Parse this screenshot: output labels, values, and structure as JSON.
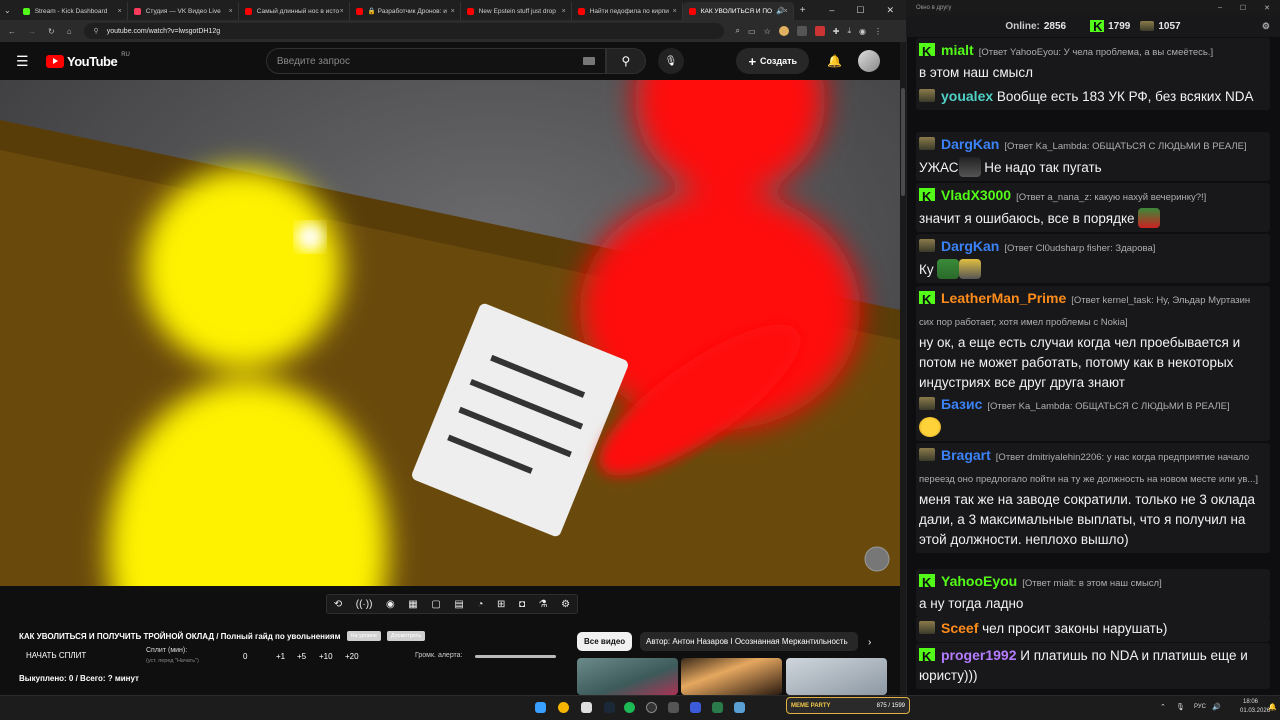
{
  "browser": {
    "tabs": [
      {
        "label": "Stream - Kick Dashboard",
        "color": "#53fc18",
        "active": false
      },
      {
        "label": "Студия — VK Видео Live",
        "color": "#ff3b5c",
        "active": false
      },
      {
        "label": "Самый длинный нос в исто",
        "color": "#ff0000",
        "active": false
      },
      {
        "label": "🔒 Разработчик Дронов: и",
        "color": "#ff0000",
        "active": false
      },
      {
        "label": "New Epstein stuff just drop",
        "color": "#ff0000",
        "active": false
      },
      {
        "label": "Найти педофила по кирпи",
        "color": "#ff0000",
        "active": false
      },
      {
        "label": "КАК УВОЛИТЬСЯ И ПО",
        "color": "#ff0000",
        "active": true
      }
    ],
    "new_tab": "+",
    "url": "youtube.com/watch?v=lwsgotDH12g"
  },
  "youtube": {
    "logo_text": "YouTube",
    "region": "RU",
    "search_placeholder": "Введите запрос",
    "create_label": "Создать",
    "create_plus": "+"
  },
  "video": {
    "title": "КАК УВОЛИТЬСЯ И ПОЛУЧИТЬ ТРОЙНОЙ ОКЛАД / Полный гайд по увольнениям",
    "chip1": "На уровне",
    "chip2": "Досмотреть"
  },
  "split": {
    "start_label": "НАЧАТЬ СПЛИТ",
    "split_label": "Сплит (мин):",
    "split_hint": "(уст. перед \"Начать\")",
    "values": [
      "0",
      "+1",
      "+5",
      "+10",
      "+20"
    ],
    "alert_label": "Громк. алерта:",
    "bought": "Выкуплено: 0 / Всего: ? минут"
  },
  "videos_row": {
    "all_label": "Все видео",
    "author_label": "Автор: Антон Назаров I Осознанная Меркантильность"
  },
  "chat": {
    "window_title": "Окно в другу",
    "online_label": "Online:",
    "online_value": "2856",
    "kick_count": "1799",
    "vk_count": "1057",
    "messages": [
      {
        "name": "mialt",
        "color": "#53fc18",
        "badge": "kick",
        "reply": "[Ответ YahooEyou: У чела проблема, а вы смеётесь.]",
        "text": "в этом наш смысл"
      },
      {
        "name": "youalex",
        "color": "#4fd1c5",
        "badge": "vk",
        "reply": "",
        "text": "Вообще есть 183 УК РФ, без всяких NDA"
      },
      {
        "name": "DargKan",
        "color": "#3b82f6",
        "badge": "vk",
        "reply": "[Ответ Ka_Lambda: ОБЩАТЬСЯ С ЛЮДЬМИ В РЕАЛЕ]",
        "text": "Не надо так пугать",
        "prefix": "УЖАС"
      },
      {
        "name": "VladX3000",
        "color": "#53fc18",
        "badge": "kick",
        "reply": "[Ответ a_nana_z: какую нахуй вечеринку?!]",
        "text": "значит я ошибаюсь, все в порядке"
      },
      {
        "name": "DargKan",
        "color": "#3b82f6",
        "badge": "vk",
        "reply": "[Ответ Cl0udsharp fisher: Здарова]",
        "text": "Ку"
      },
      {
        "name": "LeatherMan_Prime",
        "color": "#ff8c1a",
        "badge": "kick",
        "reply": "[Ответ kernel_task: Ну, Эльдар Муртазин сих пор работает, хотя имел проблемы с Nokia]",
        "text": "ну ок, а еще есть случаи когда чел проебывается и потом не может работать, потому как в некоторых индустриях все друг друга знают"
      },
      {
        "name": "Базис",
        "color": "#3b82f6",
        "badge": "vk",
        "reply": "[Ответ Ka_Lambda: ОБЩАТЬСЯ С ЛЮДЬМИ В РЕАЛЕ]",
        "text": ""
      },
      {
        "name": "Bragart",
        "color": "#3b82f6",
        "badge": "vk",
        "reply": "[Ответ dmitriyalehin2206: у нас когда предприятие начало переезд оно предлогало пойти на ту же должность на новом месте или ув...]",
        "text": "меня так же на заводе сократили. только не 3 оклада дали, а 3 максимальные выплаты, что я получил на этой должности. неплохо вышло)"
      },
      {
        "name": "YahooEyou",
        "color": "#53fc18",
        "badge": "kick",
        "reply": "[Ответ mialt: в этом наш смысл]",
        "text": "а ну тогда ладно"
      },
      {
        "name": "Sceef",
        "color": "#ff8c1a",
        "badge": "vk",
        "reply": "",
        "text": "чел просит законы нарушать)"
      },
      {
        "name": "proger1992",
        "color": "#b57cff",
        "badge": "kick",
        "reply": "",
        "text": "И платишь по NDA и платишь еще и юристу)))"
      }
    ]
  },
  "taskbar": {
    "meme_label": "MEME PARTY",
    "meme_count": "875 / 1599",
    "lang": "РУС",
    "time": "18:06",
    "date": "01.03.2026"
  },
  "colors": {
    "yt_red": "#ff0000",
    "kick_green": "#53fc18",
    "bg": "#0f0f0f"
  }
}
